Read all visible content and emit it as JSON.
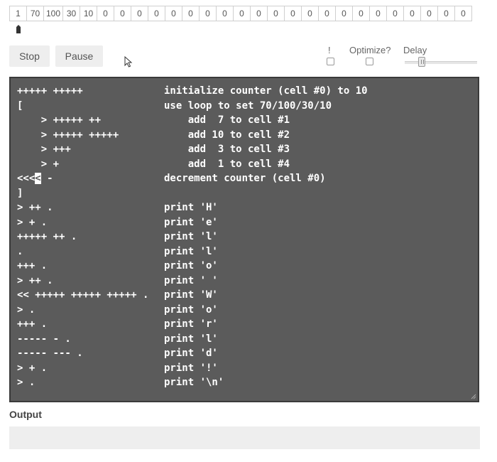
{
  "memory": {
    "cells": [
      "1",
      "70",
      "100",
      "30",
      "10",
      "0",
      "0",
      "0",
      "0",
      "0",
      "0",
      "0",
      "0",
      "0",
      "0",
      "0",
      "0",
      "0",
      "0",
      "0",
      "0",
      "0",
      "0",
      "0",
      "0",
      "0",
      "0"
    ],
    "pointer_index": 0
  },
  "controls": {
    "stop_label": "Stop",
    "pause_label": "Pause",
    "debug_label": "!",
    "optimize_label": "Optimize?",
    "delay_label": "Delay",
    "debug_checked": false,
    "optimize_checked": false
  },
  "editor": {
    "caret_line": 6,
    "lines": [
      {
        "code": "+++++ +++++",
        "comment": "initialize counter (cell #0) to 10"
      },
      {
        "code": "[",
        "comment": "use loop to set 70/100/30/10"
      },
      {
        "code": "    > +++++ ++",
        "comment": "    add  7 to cell #1"
      },
      {
        "code": "    > +++++ +++++",
        "comment": "    add 10 to cell #2"
      },
      {
        "code": "    > +++",
        "comment": "    add  3 to cell #3"
      },
      {
        "code": "    > +",
        "comment": "    add  1 to cell #4"
      },
      {
        "code": "<<<< -",
        "comment": "decrement counter (cell #0)"
      },
      {
        "code": "]",
        "comment": ""
      },
      {
        "code": "> ++ .",
        "comment": "print 'H'"
      },
      {
        "code": "> + .",
        "comment": "print 'e'"
      },
      {
        "code": "+++++ ++ .",
        "comment": "print 'l'"
      },
      {
        "code": ".",
        "comment": "print 'l'"
      },
      {
        "code": "+++ .",
        "comment": "print 'o'"
      },
      {
        "code": "> ++ .",
        "comment": "print ' '"
      },
      {
        "code": "<< +++++ +++++ +++++ .",
        "comment": "print 'W'"
      },
      {
        "code": "> .",
        "comment": "print 'o'"
      },
      {
        "code": "+++ .",
        "comment": "print 'r'"
      },
      {
        "code": "----- - .",
        "comment": "print 'l'"
      },
      {
        "code": "----- --- .",
        "comment": "print 'd'"
      },
      {
        "code": "> + .",
        "comment": "print '!'"
      },
      {
        "code": "> .",
        "comment": "print '\\n'"
      }
    ]
  },
  "output": {
    "label": "Output",
    "value": ""
  },
  "colors": {
    "editor_bg": "#5b5b5b",
    "button_bg": "#eeeeee"
  }
}
